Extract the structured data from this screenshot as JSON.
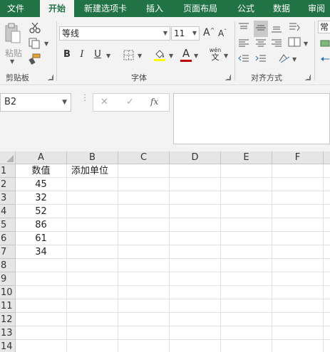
{
  "tabs": [
    "文件",
    "开始",
    "新建选项卡",
    "插入",
    "页面布局",
    "公式",
    "数据",
    "审阅"
  ],
  "ribbon": {
    "paste_label": "粘贴",
    "font_name": "等线",
    "font_size": "11",
    "bold": "B",
    "italic": "I",
    "underline": "U",
    "phonetic_top": "wén",
    "phonetic_bottom": "文",
    "font_grow": "A",
    "font_shrink": "A",
    "font_color": "A",
    "groups": {
      "clipboard": "剪贴板",
      "font": "字体",
      "alignment": "对齐方式"
    },
    "style_peek": "常",
    "accent_color": "#217346",
    "font_color_bar": "#c00000",
    "fill_color_bar": "#ffff00"
  },
  "formula_bar": {
    "name_box": "B2",
    "cancel": "✕",
    "enter": "✓",
    "fx": "fx",
    "formula": ""
  },
  "sheet": {
    "columns": [
      "A",
      "B",
      "C",
      "D",
      "E",
      "F"
    ],
    "rows": [
      "1",
      "2",
      "3",
      "4",
      "5",
      "6",
      "7",
      "8",
      "9",
      "10",
      "11",
      "12",
      "13",
      "14"
    ],
    "cells": {
      "A1": "数值",
      "B1": "添加单位",
      "A2": "45",
      "A3": "32",
      "A4": "52",
      "A5": "86",
      "A6": "61",
      "A7": "34"
    },
    "selected_cell": "B2"
  }
}
